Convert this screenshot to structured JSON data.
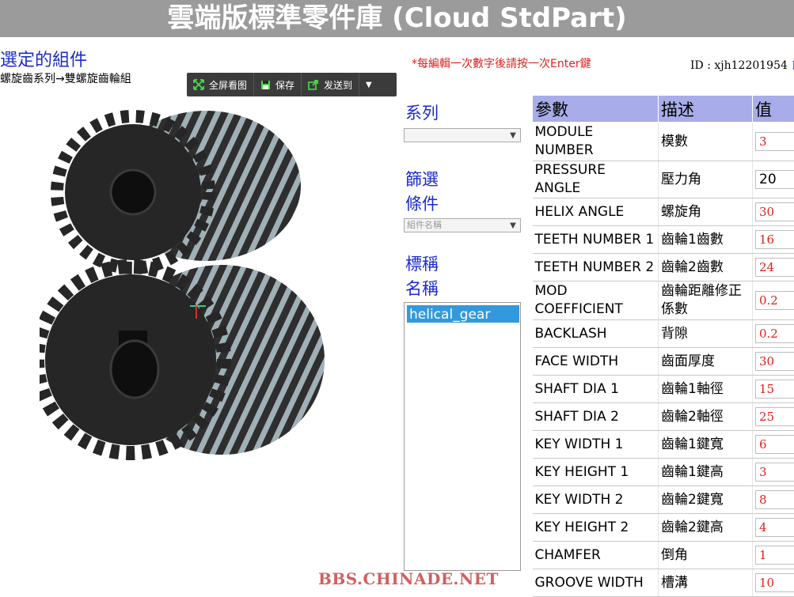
{
  "app_title": "雲端版標準零件庫 (Cloud StdPart)",
  "heading": "選定的組件",
  "breadcrumb": "螺旋齒系列→雙螺旋齒輪組",
  "toolbar": {
    "fullscreen": "全屏看图",
    "save": "保存",
    "send": "发送到"
  },
  "notice": "*每編輯一次數字後請按一次Enter鍵",
  "user_id": "ID : xjh12201954",
  "user_extra": "饋",
  "side": {
    "series_label": "系列",
    "filter_label1": "篩選",
    "filter_label2": "條件",
    "filter_placeholder": "組件名稱",
    "std_label1": "標稱",
    "std_label2": "名稱",
    "list_items": [
      "helical_gear"
    ]
  },
  "table": {
    "headers": [
      "參數",
      "描述",
      "值"
    ],
    "rows": [
      {
        "name": "MODULE NUMBER",
        "desc": "模數",
        "value": "3"
      },
      {
        "name": "PRESSURE ANGLE",
        "desc": "壓力角",
        "value": "20"
      },
      {
        "name": "HELIX ANGLE",
        "desc": "螺旋角",
        "value": "30"
      },
      {
        "name": "TEETH NUMBER 1",
        "desc": "齒輪1齒數",
        "value": "16"
      },
      {
        "name": "TEETH NUMBER 2",
        "desc": "齒輪2齒數",
        "value": "24"
      },
      {
        "name": "MOD COEFFICIENT",
        "desc": "齒輪距離修正係數",
        "value": "0.2"
      },
      {
        "name": "BACKLASH",
        "desc": "背隙",
        "value": "0.2"
      },
      {
        "name": "FACE WIDTH",
        "desc": "齒面厚度",
        "value": "30"
      },
      {
        "name": "SHAFT DIA 1",
        "desc": "齒輪1軸徑",
        "value": "15"
      },
      {
        "name": "SHAFT DIA 2",
        "desc": "齒輪2軸徑",
        "value": "25"
      },
      {
        "name": "KEY WIDTH 1",
        "desc": "齒輪1鍵寬",
        "value": "6"
      },
      {
        "name": "KEY HEIGHT 1",
        "desc": "齒輪1鍵高",
        "value": "3"
      },
      {
        "name": "KEY WIDTH 2",
        "desc": "齒輪2鍵寬",
        "value": "8"
      },
      {
        "name": "KEY HEIGHT 2",
        "desc": "齒輪2鍵高",
        "value": "4"
      },
      {
        "name": "CHAMFER",
        "desc": "倒角",
        "value": "1"
      },
      {
        "name": "GROOVE WIDTH",
        "desc": "槽溝",
        "value": "10"
      }
    ]
  },
  "watermark": "BBS.CHINADE.NET",
  "colors": {
    "accent": "#1a2bcc",
    "warn": "#e02020",
    "header": "#a8ace8",
    "title_bg": "#9b9b9b"
  }
}
